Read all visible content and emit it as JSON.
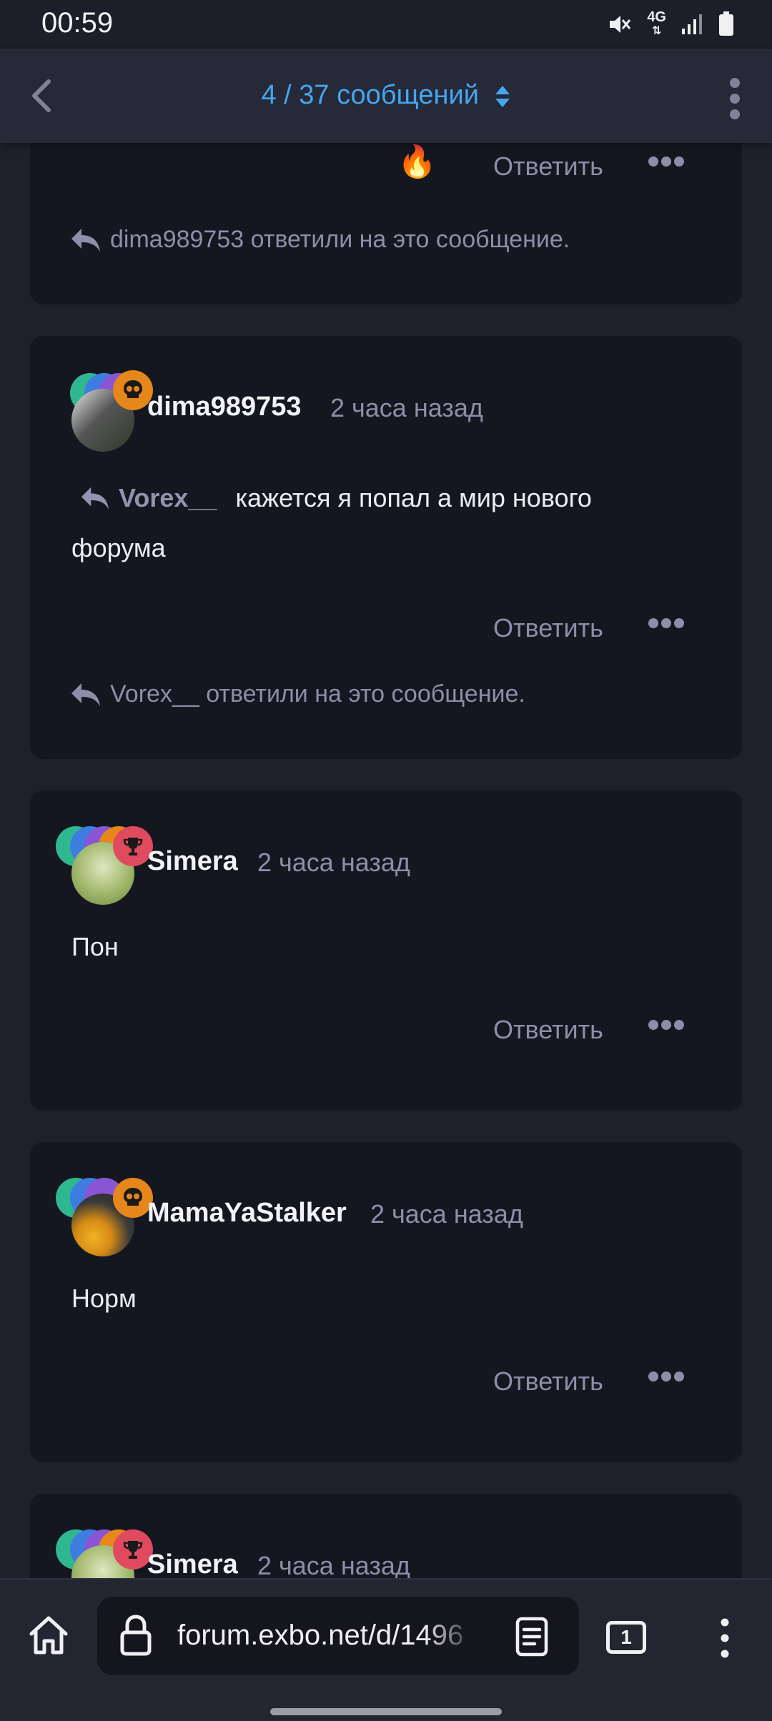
{
  "status_bar": {
    "time": "00:59",
    "network": "4G",
    "icons": [
      "mute-icon",
      "signal-icon",
      "battery-icon"
    ]
  },
  "header": {
    "title": "4 / 37 сообщений",
    "accent_color": "#45a6f0"
  },
  "posts": [
    {
      "partial": true,
      "reaction": "🔥",
      "reply_label": "Ответить",
      "replied_text": "dima989753 ответили на это сообщение."
    },
    {
      "username": "dima989753",
      "time": "2 часа назад",
      "mention": "Vorex__",
      "text_line1": "кажется я попал а мир нового",
      "text_line2": "форума",
      "reply_label": "Ответить",
      "replied_text": "Vorex__ ответили на это сообщение."
    },
    {
      "username": "Simera",
      "time": "2 часа назад",
      "text": "Пон",
      "reply_label": "Ответить"
    },
    {
      "username": "MamaYaStalker",
      "time": "2 часа назад",
      "text": "Норм",
      "reply_label": "Ответить"
    },
    {
      "username": "Simera",
      "time": "2 часа назад"
    }
  ],
  "browser": {
    "url": "forum.exbo.net/d/1496",
    "tab_count": "1"
  }
}
